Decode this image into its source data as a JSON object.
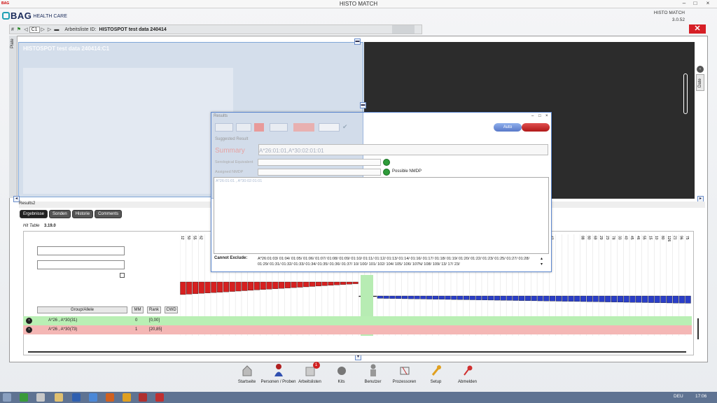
{
  "window": {
    "title": "HISTO MATCH",
    "app_mini": "BAG",
    "minimize": "–",
    "maximize": "□",
    "close": "×"
  },
  "brand": {
    "logo": "BAG",
    "sub": "HEALTH CARE",
    "version_name": "HISTO MATCH",
    "version": "3.0.52"
  },
  "worklist": {
    "label": "Arbeitsliste ID:",
    "value": "HISTOSPOT test data 240414",
    "chip": "C1"
  },
  "panels": {
    "plate_tab": "Plate",
    "date_tab": "Date",
    "ghost_title": "HISTOSPOT test data 240414:C1"
  },
  "results": {
    "header": "Results2",
    "tabs": [
      "Ergebnisse",
      "Sonden",
      "Historie",
      "Comments"
    ],
    "hit_label": "Hit Table",
    "hit_value": "3.19.0",
    "columns": {
      "group": "Group/Allele",
      "mm": "MM",
      "rank": "Rank",
      "cwd": "CWD"
    },
    "rows": [
      {
        "allele": "A*26 , A*30(31)",
        "mm": "0",
        "rank": "[0,00]"
      },
      {
        "allele": "A*26 , A*30(73)",
        "mm": "1",
        "rank": "[20,85]"
      }
    ],
    "probe_headers": [
      "12",
      "50",
      "55",
      "62",
      "",
      "",
      "",
      "",
      "",
      "",
      "",
      "",
      "",
      "",
      "",
      "",
      "",
      "",
      "",
      "",
      "",
      "",
      "",
      "",
      "",
      "",
      "",
      "",
      "",
      "",
      "",
      "",
      "",
      "",
      "",
      "",
      "",
      "",
      "",
      "",
      "",
      "",
      "",
      "",
      "",
      "",
      "",
      "",
      "",
      "",
      "",
      "",
      "",
      "",
      "",
      "",
      "",
      "",
      "",
      "",
      "42",
      "",
      "",
      "",
      "",
      "88",
      "80",
      "69",
      "29",
      "23",
      "78",
      "33",
      "40",
      "45",
      "46",
      "55",
      "15",
      "10",
      "80",
      "126",
      "21",
      "96",
      "75"
    ]
  },
  "dialog": {
    "title": "Results",
    "suggested": "Suggested Result",
    "summary_label": "Summary",
    "summary_value": "A*26:01:01,A*30:02:01:01",
    "row1_label": "Serological Equivalent",
    "row2_label": "Assigned NMDP",
    "possible": "Possible NMDP",
    "list_text": "A*26:01:01 , A*30:02:01:01",
    "auto_btn": "Auto",
    "cannot_label": "Cannot Exclude:",
    "cannot_text": "A*26:01:03/ 01:04/ 01:05/ 01:06/ 01:07/ 01:08/ 01:09/ 01:10/ 01:11/ 01:12/ 01:13/ 01:14/ 01:16/ 01:17/ 01:18/ 01:19/ 01:20/ 01:22/ 01:23/ 01:25/ 01:27/ 01:28/ 01:29/ 01:31/ 01:32/ 01:33/ 01:34/ 01:35/ 01:36/ 01:37/ 10/ 100/ 101/ 102/ 104/ 105/ 106/ 107N/ 108/ 109/ 13/ 17/ 23/"
  },
  "dock": [
    {
      "label": "Startseite",
      "icon": "house-icon"
    },
    {
      "label": "Personen / Proben",
      "icon": "person-icon"
    },
    {
      "label": "Arbeitslisten",
      "icon": "folder-icon",
      "badge": "1"
    },
    {
      "label": "Kits",
      "icon": "sphere-icon"
    },
    {
      "label": "Benutzer",
      "icon": "user-icon"
    },
    {
      "label": "Prozessoren",
      "icon": "processor-icon"
    },
    {
      "label": "Setup",
      "icon": "wrench-icon"
    },
    {
      "label": "Abmelden",
      "icon": "key-icon"
    }
  ],
  "taskbar": {
    "lang": "DEU",
    "time": "17:06"
  },
  "colors": {
    "accent": "#1fa0b4",
    "close_red": "#d61f26",
    "row_green": "#b9efb4",
    "row_red": "#f4b7b5",
    "bar_red": "#d62020",
    "bar_blue": "#2a3ec8"
  }
}
